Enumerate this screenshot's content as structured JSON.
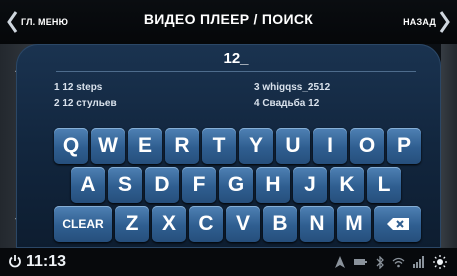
{
  "header": {
    "back_menu_label": "ГЛ. МЕНЮ",
    "title": "ВИДЕО ПЛЕЕР / ПОИСК",
    "back_label": "НАЗАД"
  },
  "search": {
    "value": "12_"
  },
  "results": [
    {
      "label": "1 12 steps"
    },
    {
      "label": "2 12 стульев"
    },
    {
      "label": "3 whigqss_2512"
    },
    {
      "label": "4 Свадьба 12"
    }
  ],
  "keyboard": {
    "row1": [
      "Q",
      "W",
      "E",
      "R",
      "T",
      "Y",
      "U",
      "I",
      "O",
      "P"
    ],
    "row2": [
      "A",
      "S",
      "D",
      "F",
      "G",
      "H",
      "J",
      "K",
      "L"
    ],
    "row3": [
      "CLEAR",
      "Z",
      "X",
      "C",
      "V",
      "B",
      "N",
      "M"
    ]
  },
  "status": {
    "time": "11:13",
    "icons": [
      "navigation-icon",
      "battery-icon",
      "bluetooth-icon",
      "wifi-icon",
      "signal-icon",
      "brightness-icon"
    ]
  },
  "colors": {
    "key": "#2f5e90",
    "panel": "#12263e",
    "background": "#0b0f14"
  }
}
